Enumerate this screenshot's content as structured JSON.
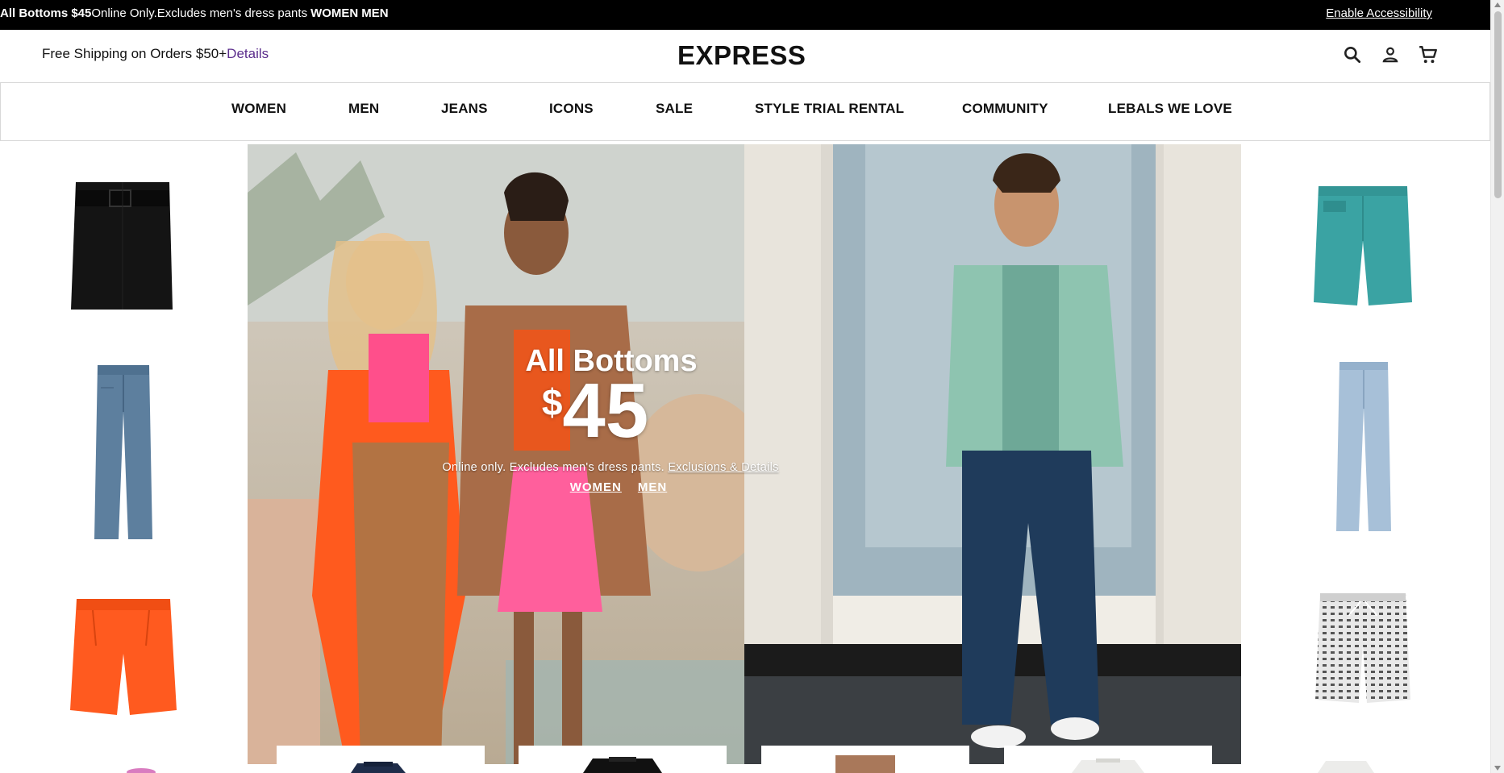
{
  "promo_bar": {
    "headline": "All Bottoms $45",
    "detail": "Online Only.Excludes men's dress pants",
    "link_women": "WOMEN",
    "link_men": "MEN",
    "accessibility": "Enable Accessibility"
  },
  "header": {
    "shipping_text": "Free Shipping on Orders $50+",
    "shipping_link": "Details",
    "logo": "EXPRESS",
    "icons": [
      "search-icon",
      "account-icon",
      "cart-icon"
    ]
  },
  "nav": {
    "items": [
      "WOMEN",
      "MEN",
      "JEANS",
      "ICONS",
      "SALE",
      "STYLE TRIAL RENTAL",
      "COMMUNITY",
      "LEBALS WE LOVE"
    ]
  },
  "hero": {
    "title": "All Bottoms",
    "currency": "$",
    "price": "45",
    "subtitle": "Online only. Excludes men's dress pants.",
    "details_link": "Exclusions & Details",
    "link_women": "WOMEN",
    "link_men": "MEN"
  },
  "products_left": [
    "black-belted-mini-skirt",
    "blue-wide-leg-jeans",
    "orange-pleated-shorts"
  ],
  "products_right": [
    "teal-bermuda-shorts",
    "light-wash-straight-jeans",
    "patterned-drawstring-shorts"
  ],
  "colors": {
    "promo_bg": "#000000",
    "link_purple": "#5b2d8c",
    "hero_left_bg": "#c9b89e",
    "hero_right_bg": "#d9d4cc"
  }
}
